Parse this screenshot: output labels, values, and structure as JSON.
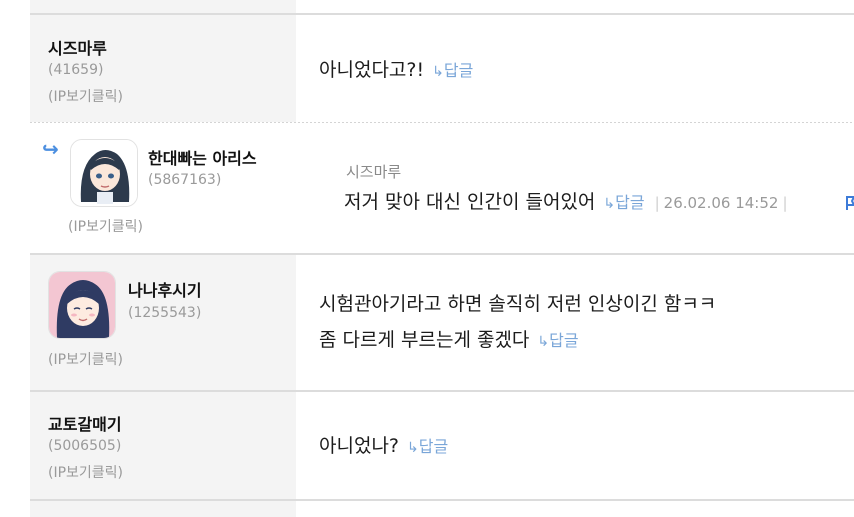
{
  "reply_label": "답글",
  "ip_label": "(IP보기클릭)",
  "comments": [
    {
      "nick": "시즈마루",
      "uid": "(41659)",
      "text": "아니었다고?!"
    },
    {
      "nick": "한대빠는 아리스",
      "uid": "(5867163)",
      "quote_to": "시즈마루",
      "text": "저거 맞아 대신 인간이 들어있어",
      "date": "26.02.06 14:52"
    },
    {
      "nick": "나나후시기",
      "uid": "(1255543)",
      "text_line1": "시험관아기라고 하면 솔직히 저런 인상이긴 함ㅋㅋ",
      "text_line2": "좀 다르게 부르는게 좋겠다"
    },
    {
      "nick": "교토갈매기",
      "uid": "(5006505)",
      "text": "아니었나?"
    }
  ],
  "colors": {
    "left_bg": "#f4f4f4",
    "reply": "#7aa6d8",
    "reply_arrow": "#4c8fe0"
  }
}
